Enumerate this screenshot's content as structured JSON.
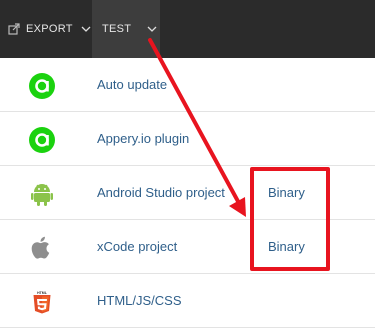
{
  "toolbar": {
    "export_label": "EXPORT",
    "test_label": "TEST"
  },
  "items": [
    {
      "label": "Auto update",
      "icon": "appery-icon",
      "link": ""
    },
    {
      "label": "Appery.io plugin",
      "icon": "appery-icon",
      "link": ""
    },
    {
      "label": "Android Studio project",
      "icon": "android-icon",
      "link": "Binary"
    },
    {
      "label": "xCode project",
      "icon": "apple-icon",
      "link": "Binary"
    },
    {
      "label": "HTML/JS/CSS",
      "icon": "html5-icon",
      "link": ""
    }
  ],
  "colors": {
    "toolbar_bg": "#2b2b2b",
    "link": "#2f5f8a",
    "appery_green": "#1bd20f",
    "android_green": "#8bc34a",
    "annotation_red": "#e8141f"
  }
}
